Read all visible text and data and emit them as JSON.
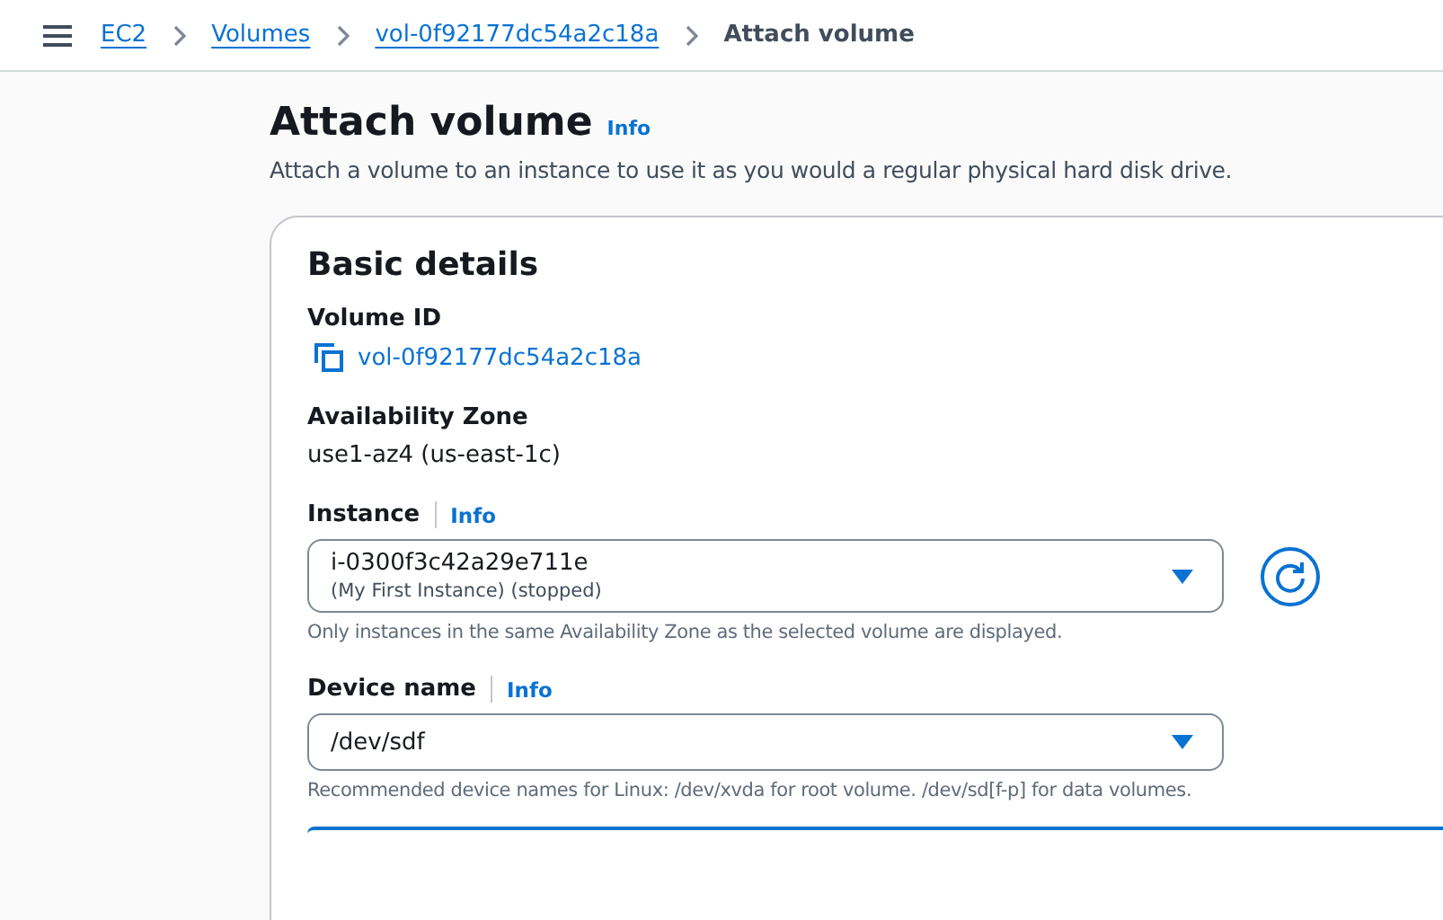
{
  "breadcrumbs": [
    {
      "label": "EC2",
      "link": true
    },
    {
      "label": "Volumes",
      "link": true
    },
    {
      "label": "vol-0f92177dc54a2c18a",
      "link": true
    },
    {
      "label": "Attach volume",
      "link": false
    }
  ],
  "page": {
    "title": "Attach volume",
    "info": "Info",
    "description": "Attach a volume to an instance to use it as you would a regular physical hard disk drive."
  },
  "card": {
    "title": "Basic details",
    "fields": [
      {
        "kind": "copy",
        "label": "Volume ID",
        "value": "vol-0f92177dc54a2c18a"
      },
      {
        "kind": "text",
        "label": "Availability Zone",
        "value": "use1-az4 (us-east-1c)"
      },
      {
        "kind": "select",
        "label": "Instance",
        "info": "Info",
        "value": "i-0300f3c42a29e711e",
        "secondary": "(My First Instance) (stopped)",
        "refresh": true,
        "hint": "Only instances in the same Availability Zone as the selected volume are displayed."
      },
      {
        "kind": "select",
        "label": "Device name",
        "info": "Info",
        "value": "/dev/sdf",
        "refresh": false,
        "hint": "Recommended device names for Linux: /dev/xvda for root volume. /dev/sd[f-p] for data volumes."
      }
    ]
  }
}
